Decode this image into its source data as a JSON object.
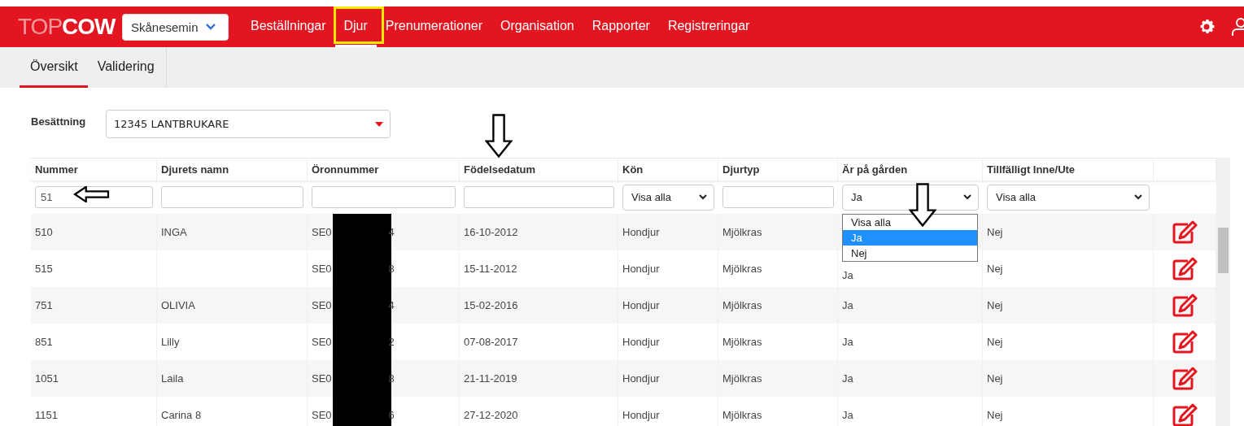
{
  "header": {
    "logo": {
      "light": "TOP",
      "bold": "COW"
    },
    "company_select": {
      "value": "Skånesemin"
    },
    "nav": [
      {
        "label": "Beställningar",
        "selected": false
      },
      {
        "label": "Djur",
        "selected": true
      },
      {
        "label": "Prenumerationer",
        "selected": false
      },
      {
        "label": "Organisation",
        "selected": false
      },
      {
        "label": "Rapporter",
        "selected": false
      },
      {
        "label": "Registreringar",
        "selected": false
      }
    ]
  },
  "subtabs": [
    {
      "label": "Översikt",
      "selected": true
    },
    {
      "label": "Validering",
      "selected": false
    }
  ],
  "herd": {
    "label": "Besättning",
    "value": "12345 LANTBRUKARE"
  },
  "table": {
    "columns": [
      "Nummer",
      "Djurets namn",
      "Öronnummer",
      "Födelsedatum",
      "Kön",
      "Djurtyp",
      "Är på gården",
      "Tillfälligt Inne/Ute"
    ],
    "filters": [
      {
        "kind": "text",
        "value": "51"
      },
      {
        "kind": "text"
      },
      {
        "kind": "text"
      },
      {
        "kind": "text"
      },
      {
        "kind": "select",
        "value": "Visa alla"
      },
      {
        "kind": "text"
      },
      {
        "kind": "select",
        "value": "Ja"
      },
      {
        "kind": "select",
        "value": "Visa alla"
      }
    ],
    "open_dropdown": [
      {
        "label": "Visa alla",
        "selected": false
      },
      {
        "label": "Ja",
        "selected": true
      },
      {
        "label": "Nej",
        "selected": false
      }
    ],
    "rows": [
      {
        "number": "510",
        "name": "INGA",
        "ear_start": "SE0",
        "ear_end": "4",
        "birth_date": "16-10-2012",
        "sex": "Hondjur",
        "type": "Mjölkras",
        "on_farm": "",
        "temporary": "Nej"
      },
      {
        "number": "515",
        "name": "",
        "ear_start": "SE0",
        "ear_end": "8",
        "birth_date": "15-11-2012",
        "sex": "Hondjur",
        "type": "Mjölkras",
        "on_farm": "Ja",
        "temporary": "Nej"
      },
      {
        "number": "751",
        "name": "OLIVIA",
        "ear_start": "SE0",
        "ear_end": "4",
        "birth_date": "15-02-2016",
        "sex": "Hondjur",
        "type": "Mjölkras",
        "on_farm": "Ja",
        "temporary": "Nej"
      },
      {
        "number": "851",
        "name": "Lilly",
        "ear_start": "SE0",
        "ear_end": "2",
        "birth_date": "07-08-2017",
        "sex": "Hondjur",
        "type": "Mjölkras",
        "on_farm": "Ja",
        "temporary": "Nej"
      },
      {
        "number": "1051",
        "name": "Laila",
        "ear_start": "SE0",
        "ear_end": "8",
        "birth_date": "21-11-2019",
        "sex": "Hondjur",
        "type": "Mjölkras",
        "on_farm": "Ja",
        "temporary": "Nej"
      },
      {
        "number": "1151",
        "name": "Carina 8",
        "ear_start": "SE0",
        "ear_end": "6",
        "birth_date": "27-12-2020",
        "sex": "Hondjur",
        "type": "Mjölkras",
        "on_farm": "Ja",
        "temporary": "Nej"
      }
    ]
  },
  "annotations": [
    {
      "kind": "arrow-down"
    },
    {
      "kind": "arrow-left"
    },
    {
      "kind": "arrow-down"
    }
  ]
}
